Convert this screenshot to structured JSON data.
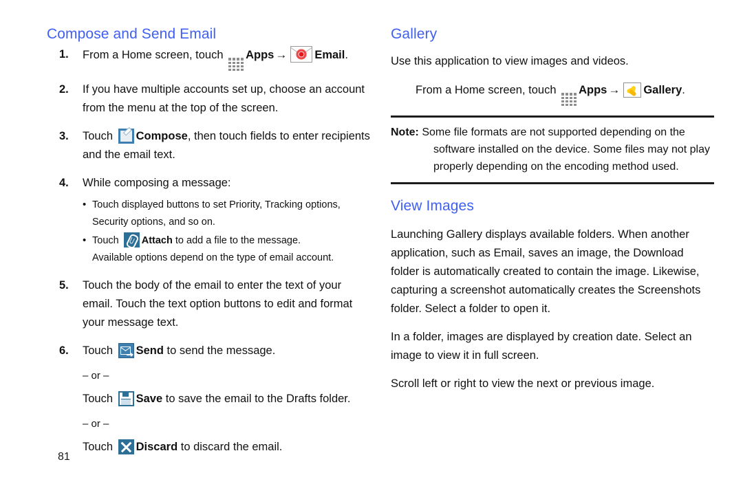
{
  "page_number": "81",
  "colors": {
    "heading_blue": "#3f5ff2",
    "body_black": "#111111",
    "icon_blue": "#2e6f96",
    "email_red": "#e8161a",
    "gallery_yellow": "#ffd21e"
  },
  "left_column": {
    "heading": "Compose and Send Email",
    "steps": [
      {
        "number": "1.",
        "parts": [
          {
            "type": "text",
            "text": "From a Home screen, touch "
          },
          {
            "type": "icon",
            "icon": "apps-grid-icon"
          },
          {
            "type": "bold",
            "text": "Apps"
          },
          {
            "type": "arrow",
            "text": "→"
          },
          {
            "type": "icon",
            "icon": "email-envelope-icon"
          },
          {
            "type": "bold",
            "text": "Email"
          },
          {
            "type": "text",
            "text": "."
          }
        ]
      },
      {
        "number": "2.",
        "parts": [
          {
            "type": "text",
            "text": "If you have multiple accounts set up, choose an account from the menu at the top of the screen."
          }
        ]
      },
      {
        "number": "3.",
        "parts": [
          {
            "type": "text",
            "text": "Touch "
          },
          {
            "type": "icon",
            "icon": "compose-pencil-icon"
          },
          {
            "type": "bold",
            "text": "Compose"
          },
          {
            "type": "text",
            "text": ", then touch fields to enter recipients and the email text."
          }
        ]
      },
      {
        "number": "4.",
        "parts": [
          {
            "type": "text",
            "text": "While composing a message:"
          }
        ],
        "bullets": [
          {
            "parts": [
              {
                "type": "text",
                "text": "Touch displayed buttons to set Priority, Tracking options, Security options, and so on."
              }
            ]
          },
          {
            "parts": [
              {
                "type": "text",
                "text": "Touch "
              },
              {
                "type": "icon",
                "icon": "attach-paperclip-icon"
              },
              {
                "type": "bold",
                "text": "Attach"
              },
              {
                "type": "text",
                "text": " to add a file to the message."
              }
            ],
            "note": "Available options depend on the type of email account."
          }
        ]
      },
      {
        "number": "5.",
        "parts": [
          {
            "type": "text",
            "text": "Touch the body of the email to enter the text of your email. Touch the text option buttons to edit and format your message text."
          }
        ]
      },
      {
        "number": "6.",
        "parts": [
          {
            "type": "text",
            "text": "Touch "
          },
          {
            "type": "icon",
            "icon": "send-envelope-arrow-icon"
          },
          {
            "type": "bold",
            "text": "Send"
          },
          {
            "type": "text",
            "text": " to send the message."
          }
        ],
        "alternatives": [
          {
            "separator": "– or –",
            "parts": [
              {
                "type": "text",
                "text": "Touch "
              },
              {
                "type": "icon",
                "icon": "save-floppy-icon"
              },
              {
                "type": "bold",
                "text": "Save"
              },
              {
                "type": "text",
                "text": " to save the email to the Drafts folder."
              }
            ]
          },
          {
            "separator": "– or –",
            "parts": [
              {
                "type": "text",
                "text": "Touch "
              },
              {
                "type": "icon",
                "icon": "discard-x-icon"
              },
              {
                "type": "bold",
                "text": "Discard"
              },
              {
                "type": "text",
                "text": " to discard the email."
              }
            ]
          }
        ]
      }
    ]
  },
  "right_column": {
    "heading": "Gallery",
    "intro": "Use this application to view images and videos.",
    "launch_line": {
      "parts": [
        {
          "type": "text",
          "text": "From a Home screen, touch "
        },
        {
          "type": "icon",
          "icon": "apps-grid-icon"
        },
        {
          "type": "bold",
          "text": "Apps"
        },
        {
          "type": "arrow",
          "text": "→"
        },
        {
          "type": "icon",
          "icon": "gallery-photo-icon"
        },
        {
          "type": "bold",
          "text": "Gallery"
        },
        {
          "type": "text",
          "text": "."
        }
      ]
    },
    "note": {
      "label": "Note:",
      "text": "Some file formats are not supported depending on the software installed on the device. Some files may not play properly depending on the encoding method used."
    },
    "subheading": "View Images",
    "paragraphs": [
      "Launching Gallery displays available folders. When another application, such as Email, saves an image, the Download folder is automatically created to contain the image. Likewise, capturing a screenshot automatically creates the Screenshots folder. Select a folder to open it.",
      "In a folder, images are displayed by creation date. Select an image to view it in full screen.",
      "Scroll left or right to view the next or previous image."
    ]
  }
}
